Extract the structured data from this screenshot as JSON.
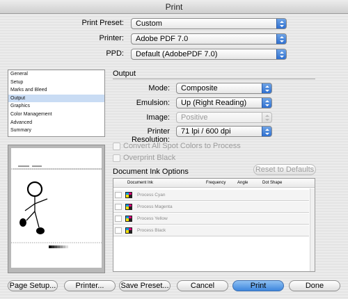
{
  "window": {
    "title": "Print"
  },
  "top": {
    "preset_label": "Print Preset:",
    "preset_value": "Custom",
    "printer_label": "Printer:",
    "printer_value": "Adobe PDF 7.0",
    "ppd_label": "PPD:",
    "ppd_value": "Default (AdobePDF 7.0)"
  },
  "sidebar": {
    "items": [
      {
        "label": "General",
        "selected": false
      },
      {
        "label": "Setup",
        "selected": false
      },
      {
        "label": "Marks and Bleed",
        "selected": false
      },
      {
        "label": "Output",
        "selected": true
      },
      {
        "label": "Graphics",
        "selected": false
      },
      {
        "label": "Color Management",
        "selected": false
      },
      {
        "label": "Advanced",
        "selected": false
      },
      {
        "label": "Summary",
        "selected": false
      }
    ]
  },
  "output": {
    "title": "Output",
    "mode_label": "Mode:",
    "mode_value": "Composite",
    "emulsion_label": "Emulsion:",
    "emulsion_value": "Up (Right Reading)",
    "image_label": "Image:",
    "image_value": "Positive",
    "resolution_label": "Printer Resolution:",
    "resolution_value": "71 lpi / 600 dpi",
    "convert_label": "Convert All Spot Colors to Process",
    "overprint_label": "Overprint Black"
  },
  "inks": {
    "title": "Document Ink Options",
    "reset_label": "Reset to Defaults",
    "columns": [
      "Document Ink",
      "Frequency",
      "Angle",
      "Dot Shape"
    ],
    "rows": [
      {
        "name": "Process Cyan",
        "swatch": "#00a0e0"
      },
      {
        "name": "Process Magenta",
        "swatch": "#e0007a"
      },
      {
        "name": "Process Yellow",
        "swatch": "#f5e000"
      },
      {
        "name": "Process Black",
        "swatch": "#000000"
      }
    ]
  },
  "buttons": {
    "page_setup": "Page Setup...",
    "printer": "Printer...",
    "save_preset": "Save Preset...",
    "cancel": "Cancel",
    "print": "Print",
    "done": "Done"
  }
}
